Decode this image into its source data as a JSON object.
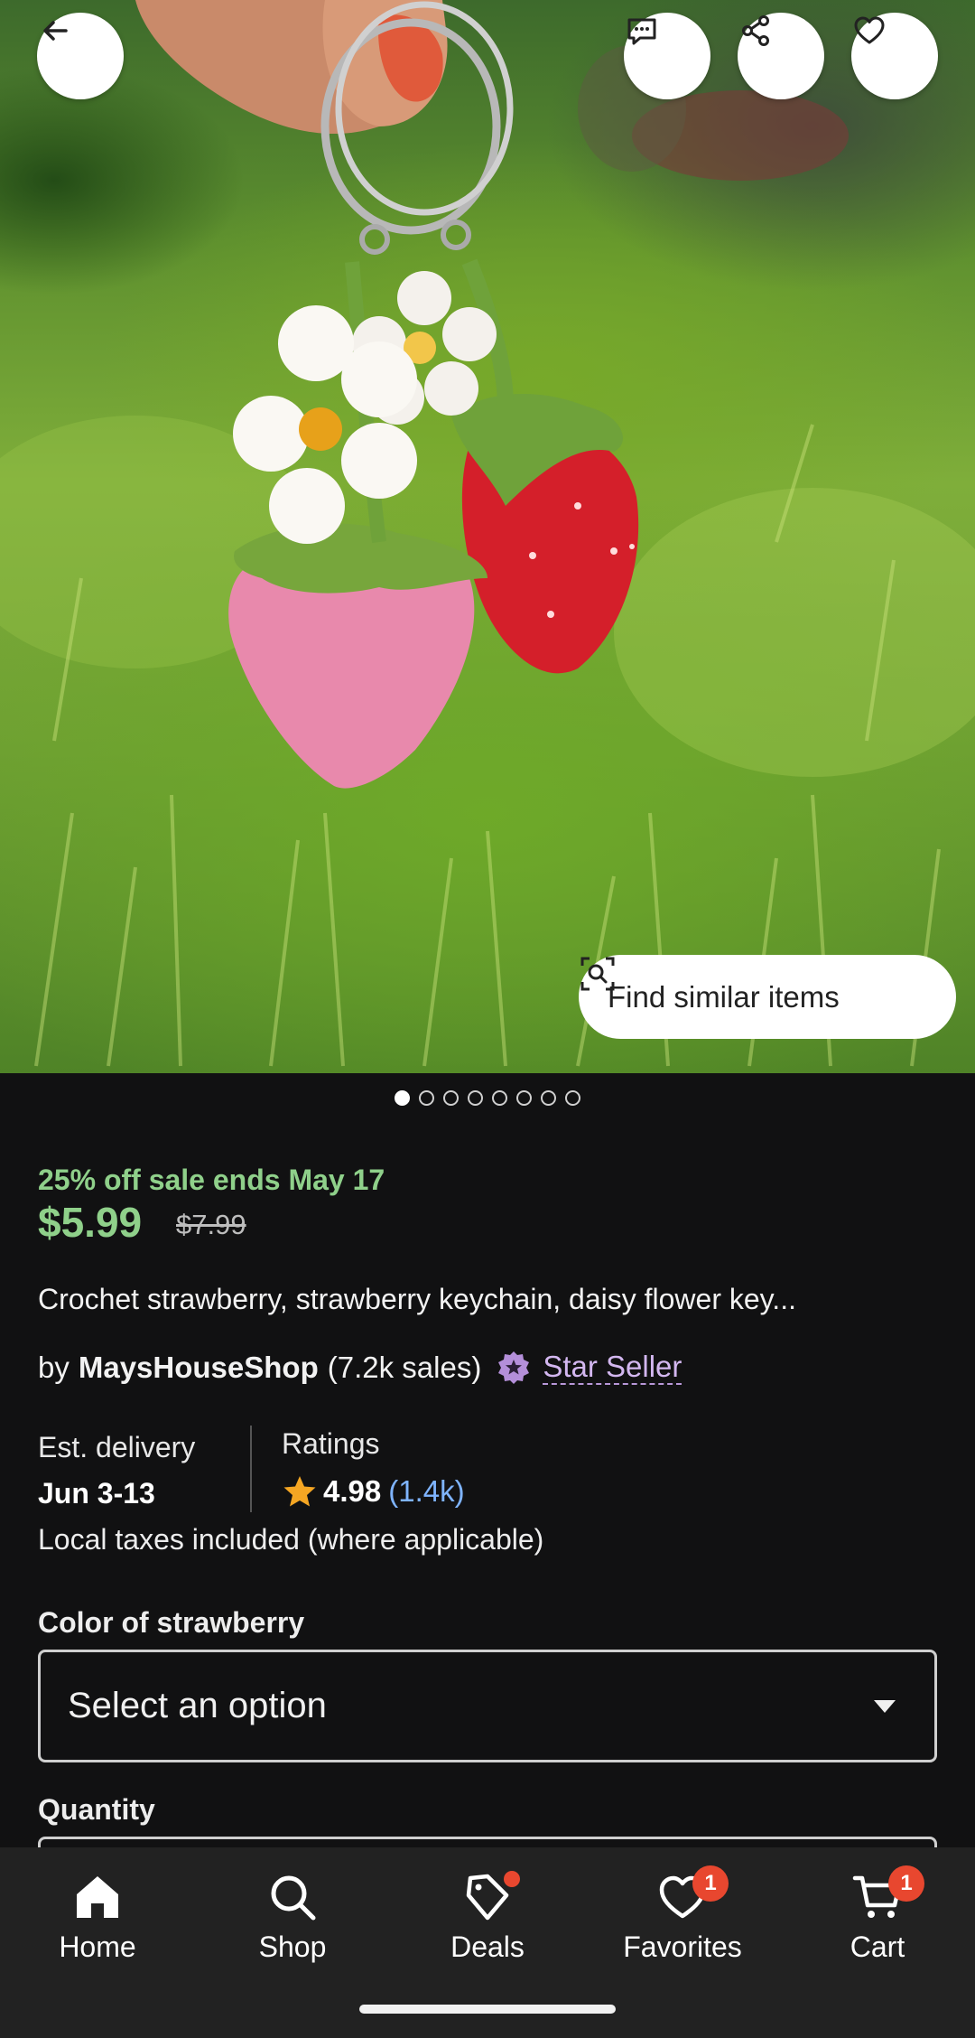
{
  "header": {
    "back_icon": "arrow-left-icon",
    "actions": [
      {
        "name": "message-seller",
        "icon": "chat-icon"
      },
      {
        "name": "share",
        "icon": "share-icon"
      },
      {
        "name": "favorite",
        "icon": "heart-outline-icon"
      }
    ]
  },
  "hero": {
    "find_similar_label": "Find similar items",
    "image_count": 8,
    "active_image": 1
  },
  "product": {
    "sale_text": "25% off sale ends May 17",
    "price": "$5.99",
    "original_price": "$7.99",
    "title": "Crochet strawberry, strawberry keychain, daisy flower key...",
    "by_text": "by",
    "shop_name": "MaysHouseShop",
    "sales": "(7.2k sales)",
    "star_seller_label": "Star Seller"
  },
  "details": {
    "delivery_label": "Est. delivery",
    "delivery_dates": "Jun 3-13",
    "ratings_label": "Ratings",
    "rating_value": "4.98",
    "rating_count": "(1.4k)",
    "taxes_text": "Local taxes included (where applicable)"
  },
  "options": {
    "color_label": "Color of strawberry",
    "color_placeholder": "Select an option",
    "quantity_label": "Quantity"
  },
  "bottom_nav": [
    {
      "label": "Home",
      "icon": "home-icon",
      "active": true
    },
    {
      "label": "Shop",
      "icon": "search-icon"
    },
    {
      "label": "Deals",
      "icon": "tag-icon",
      "dot": true
    },
    {
      "label": "Favorites",
      "icon": "heart-icon",
      "badge": "1"
    },
    {
      "label": "Cart",
      "icon": "cart-icon",
      "badge": "1"
    }
  ],
  "colors": {
    "background": "#111112",
    "sale_green": "#8fd08a",
    "link_blue": "#7fb4ff",
    "star_seller_purple": "#d3b7f0",
    "badge_red": "#e8472f",
    "nav_background": "#222222"
  }
}
